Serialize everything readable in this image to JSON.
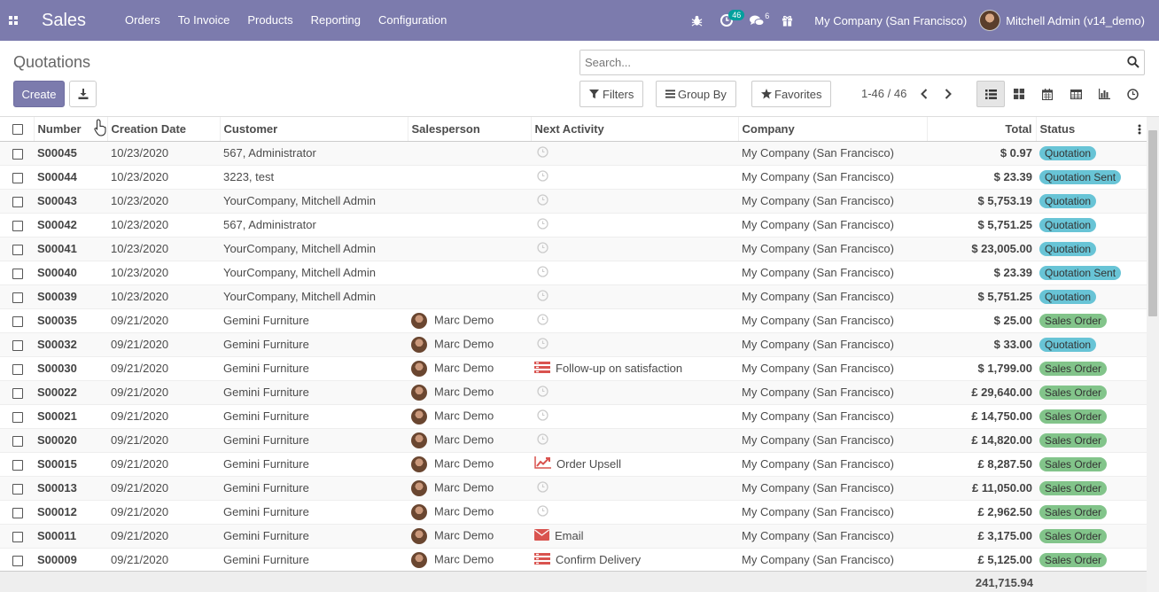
{
  "app": {
    "title": "Sales"
  },
  "menu": [
    {
      "label": "Orders"
    },
    {
      "label": "To Invoice"
    },
    {
      "label": "Products"
    },
    {
      "label": "Reporting"
    },
    {
      "label": "Configuration"
    }
  ],
  "systray": {
    "activity_count": "46",
    "messages_count": "6",
    "company": "My Company (San Francisco)",
    "user": "Mitchell Admin (v14_demo)"
  },
  "control_panel": {
    "title": "Quotations",
    "create_label": "Create",
    "search_placeholder": "Search...",
    "filters_label": "Filters",
    "groupby_label": "Group By",
    "favorites_label": "Favorites",
    "pager": "1-46 / 46"
  },
  "columns": {
    "number": "Number",
    "creation_date": "Creation Date",
    "customer": "Customer",
    "salesperson": "Salesperson",
    "next_activity": "Next Activity",
    "company": "Company",
    "total": "Total",
    "status": "Status"
  },
  "rows": [
    {
      "number": "S00045",
      "date": "10/23/2020",
      "customer": "567, Administrator",
      "salesperson": "",
      "activity": "",
      "activity_icon": "clock-icon",
      "company": "My Company (San Francisco)",
      "total": "$ 0.97",
      "status": "Quotation",
      "status_kind": "q"
    },
    {
      "number": "S00044",
      "date": "10/23/2020",
      "customer": "3223, test",
      "salesperson": "",
      "activity": "",
      "activity_icon": "clock-icon",
      "company": "My Company (San Francisco)",
      "total": "$ 23.39",
      "status": "Quotation Sent",
      "status_kind": "qs"
    },
    {
      "number": "S00043",
      "date": "10/23/2020",
      "customer": "YourCompany, Mitchell Admin",
      "salesperson": "",
      "activity": "",
      "activity_icon": "clock-icon",
      "company": "My Company (San Francisco)",
      "total": "$ 5,753.19",
      "status": "Quotation",
      "status_kind": "q"
    },
    {
      "number": "S00042",
      "date": "10/23/2020",
      "customer": "567, Administrator",
      "salesperson": "",
      "activity": "",
      "activity_icon": "clock-icon",
      "company": "My Company (San Francisco)",
      "total": "$ 5,751.25",
      "status": "Quotation",
      "status_kind": "q"
    },
    {
      "number": "S00041",
      "date": "10/23/2020",
      "customer": "YourCompany, Mitchell Admin",
      "salesperson": "",
      "activity": "",
      "activity_icon": "clock-icon",
      "company": "My Company (San Francisco)",
      "total": "$ 23,005.00",
      "status": "Quotation",
      "status_kind": "q"
    },
    {
      "number": "S00040",
      "date": "10/23/2020",
      "customer": "YourCompany, Mitchell Admin",
      "salesperson": "",
      "activity": "",
      "activity_icon": "clock-icon",
      "company": "My Company (San Francisco)",
      "total": "$ 23.39",
      "status": "Quotation Sent",
      "status_kind": "qs"
    },
    {
      "number": "S00039",
      "date": "10/23/2020",
      "customer": "YourCompany, Mitchell Admin",
      "salesperson": "",
      "activity": "",
      "activity_icon": "clock-icon",
      "company": "My Company (San Francisco)",
      "total": "$ 5,751.25",
      "status": "Quotation",
      "status_kind": "q"
    },
    {
      "number": "S00035",
      "date": "09/21/2020",
      "customer": "Gemini Furniture",
      "salesperson": "Marc Demo",
      "activity": "",
      "activity_icon": "clock-icon",
      "company": "My Company (San Francisco)",
      "total": "$ 25.00",
      "status": "Sales Order",
      "status_kind": "so"
    },
    {
      "number": "S00032",
      "date": "09/21/2020",
      "customer": "Gemini Furniture",
      "salesperson": "Marc Demo",
      "activity": "",
      "activity_icon": "clock-icon",
      "company": "My Company (San Francisco)",
      "total": "$ 33.00",
      "status": "Quotation",
      "status_kind": "q"
    },
    {
      "number": "S00030",
      "date": "09/21/2020",
      "customer": "Gemini Furniture",
      "salesperson": "Marc Demo",
      "activity": "Follow-up on satisfaction",
      "activity_icon": "tasks-icon",
      "company": "My Company (San Francisco)",
      "total": "$ 1,799.00",
      "status": "Sales Order",
      "status_kind": "so"
    },
    {
      "number": "S00022",
      "date": "09/21/2020",
      "customer": "Gemini Furniture",
      "salesperson": "Marc Demo",
      "activity": "",
      "activity_icon": "clock-icon",
      "company": "My Company (San Francisco)",
      "total": "£ 29,640.00",
      "status": "Sales Order",
      "status_kind": "so"
    },
    {
      "number": "S00021",
      "date": "09/21/2020",
      "customer": "Gemini Furniture",
      "salesperson": "Marc Demo",
      "activity": "",
      "activity_icon": "clock-icon",
      "company": "My Company (San Francisco)",
      "total": "£ 14,750.00",
      "status": "Sales Order",
      "status_kind": "so"
    },
    {
      "number": "S00020",
      "date": "09/21/2020",
      "customer": "Gemini Furniture",
      "salesperson": "Marc Demo",
      "activity": "",
      "activity_icon": "clock-icon",
      "company": "My Company (San Francisco)",
      "total": "£ 14,820.00",
      "status": "Sales Order",
      "status_kind": "so"
    },
    {
      "number": "S00015",
      "date": "09/21/2020",
      "customer": "Gemini Furniture",
      "salesperson": "Marc Demo",
      "activity": "Order Upsell",
      "activity_icon": "chart-line-icon",
      "company": "My Company (San Francisco)",
      "total": "£ 8,287.50",
      "status": "Sales Order",
      "status_kind": "so"
    },
    {
      "number": "S00013",
      "date": "09/21/2020",
      "customer": "Gemini Furniture",
      "salesperson": "Marc Demo",
      "activity": "",
      "activity_icon": "clock-icon",
      "company": "My Company (San Francisco)",
      "total": "£ 11,050.00",
      "status": "Sales Order",
      "status_kind": "so"
    },
    {
      "number": "S00012",
      "date": "09/21/2020",
      "customer": "Gemini Furniture",
      "salesperson": "Marc Demo",
      "activity": "",
      "activity_icon": "clock-icon",
      "company": "My Company (San Francisco)",
      "total": "£ 2,962.50",
      "status": "Sales Order",
      "status_kind": "so"
    },
    {
      "number": "S00011",
      "date": "09/21/2020",
      "customer": "Gemini Furniture",
      "salesperson": "Marc Demo",
      "activity": "Email",
      "activity_icon": "envelope-icon",
      "company": "My Company (San Francisco)",
      "total": "£ 3,175.00",
      "status": "Sales Order",
      "status_kind": "so"
    },
    {
      "number": "S00009",
      "date": "09/21/2020",
      "customer": "Gemini Furniture",
      "salesperson": "Marc Demo",
      "activity": "Confirm Delivery",
      "activity_icon": "tasks-icon",
      "company": "My Company (San Francisco)",
      "total": "£ 5,125.00",
      "status": "Sales Order",
      "status_kind": "so"
    }
  ],
  "footer": {
    "total": "241,715.94"
  },
  "colors": {
    "navbar": "#7c7bad",
    "quotation_badge": "#68c4d6",
    "sales_order_badge": "#82c48a",
    "activity_icon": "#d9534f"
  }
}
